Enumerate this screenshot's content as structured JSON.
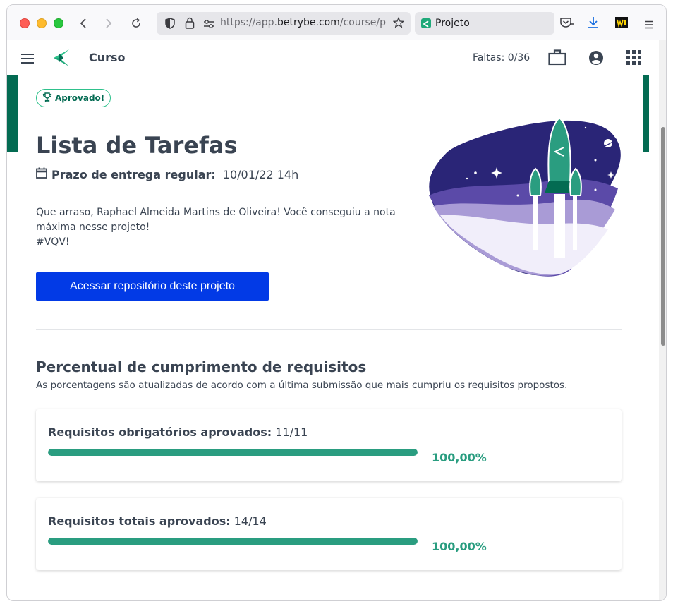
{
  "browser": {
    "url_prefix": "https://app.",
    "url_domain": "betrybe.com",
    "url_path": "/course/p",
    "tab_title": "Projeto"
  },
  "app_header": {
    "course_label": "Curso",
    "faltas": "Faltas: 0/36"
  },
  "project": {
    "badge": "Aprovado!",
    "title": "Lista de Tarefas",
    "deadline_label": "Prazo de entrega regular:",
    "deadline_value": "10/01/22 14h",
    "message_line1": "Que arraso, Raphael Almeida Martins de Oliveira! Você conseguiu a nota máxima nesse projeto!",
    "message_line2": "#VQV!",
    "repo_button": "Acessar repositório deste projeto"
  },
  "requirements": {
    "title": "Percentual de cumprimento de requisitos",
    "subtitle": "As porcentagens são atualizadas de acordo com a última submissão que mais cumpriu os requisitos propostos.",
    "cards": [
      {
        "label": "Requisitos obrigatórios aprovados:",
        "value": "11/11",
        "percent_text": "100,00%",
        "progress": 1.0
      },
      {
        "label": "Requisitos totais aprovados:",
        "value": "14/14",
        "percent_text": "100,00%",
        "progress": 1.0
      }
    ]
  },
  "colors": {
    "brand_green": "#036b52",
    "progress_green": "#2a9d80",
    "button_blue": "#023ae6"
  }
}
